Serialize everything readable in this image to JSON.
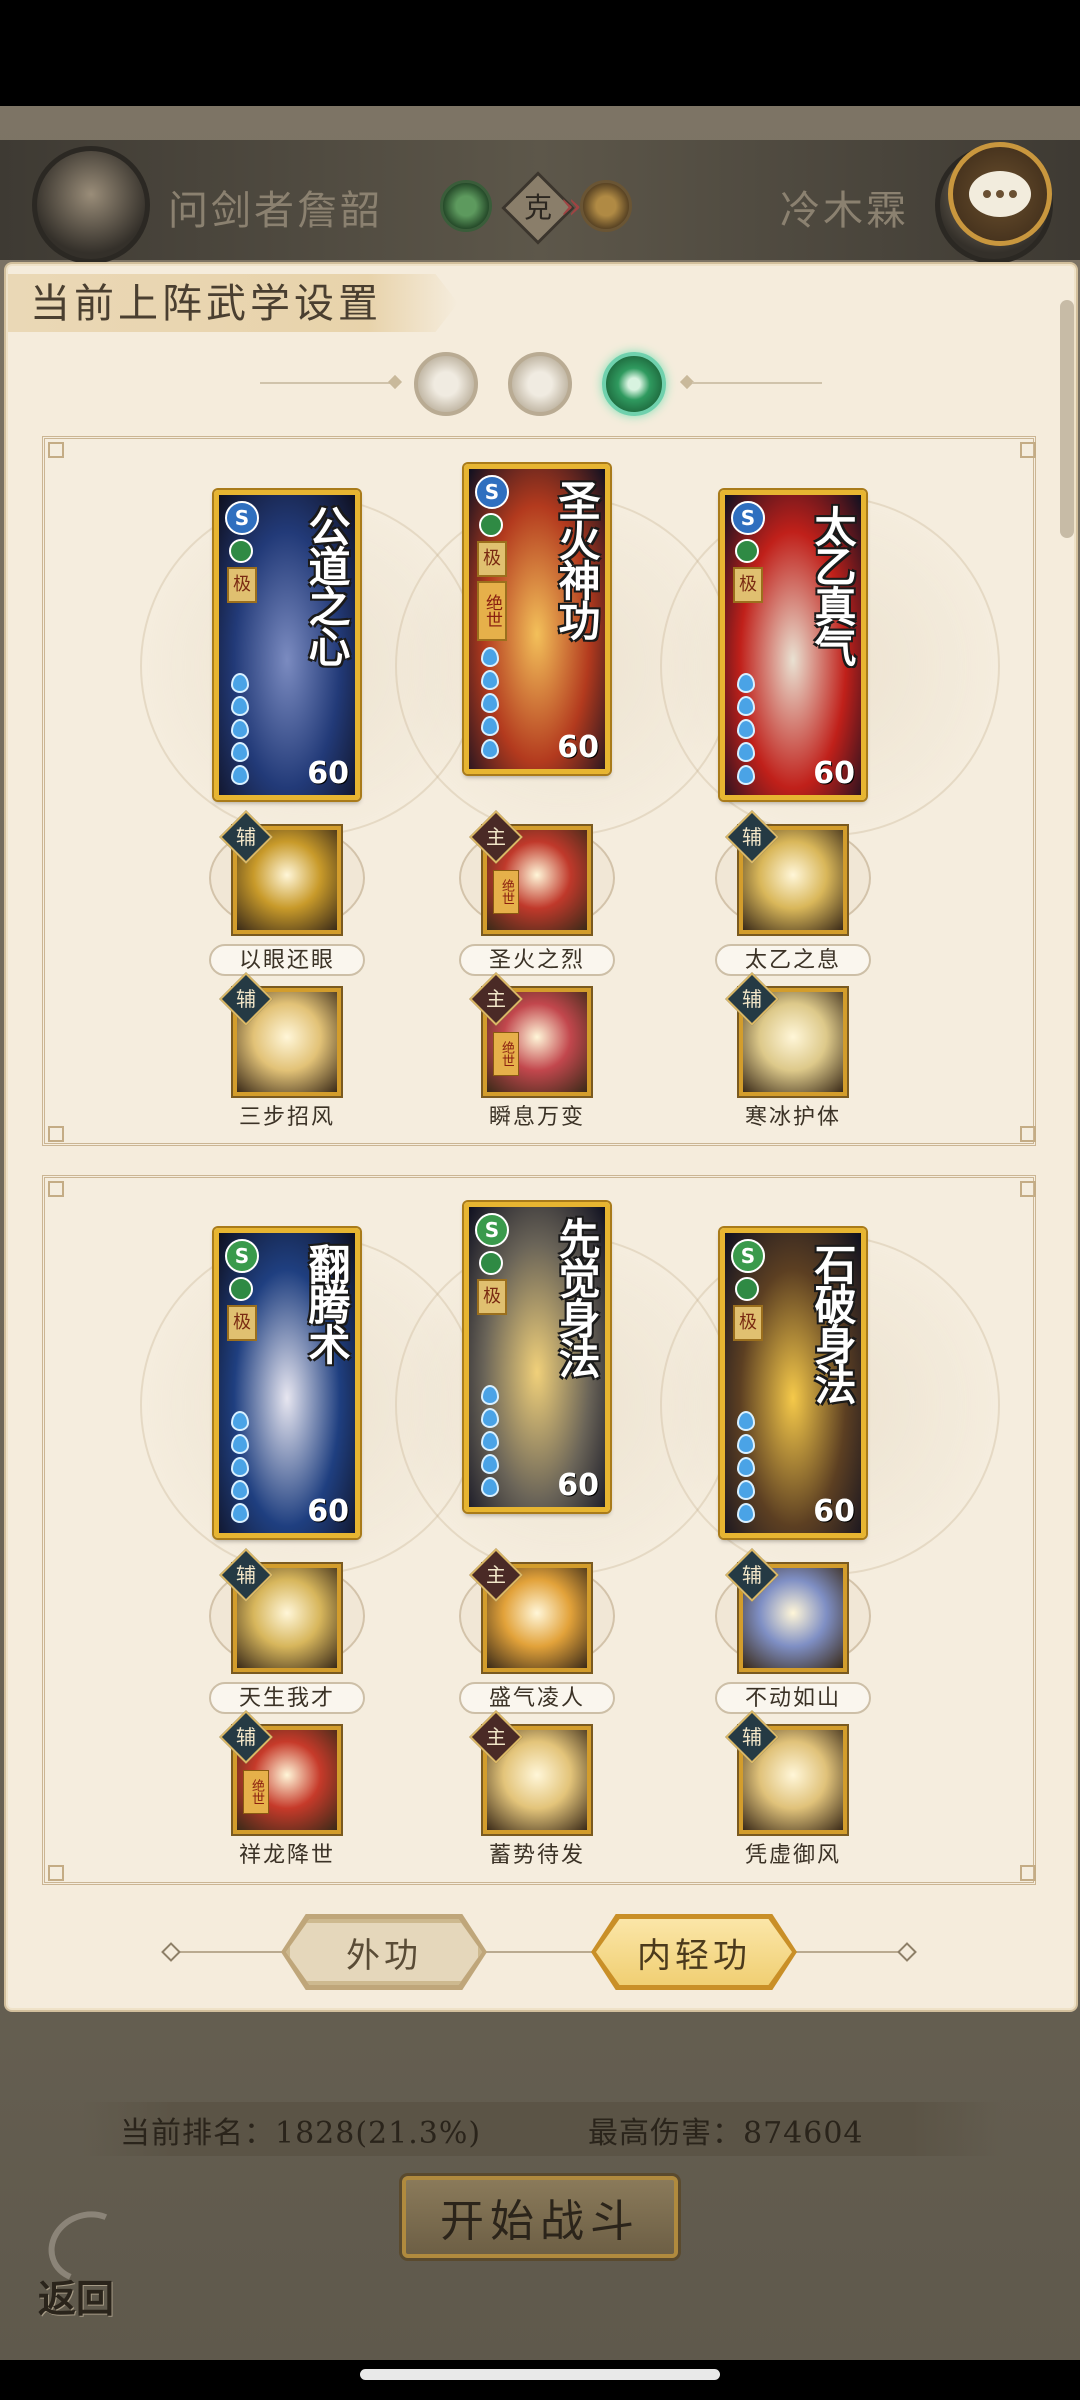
{
  "header": {
    "player_left": "问剑者詹韶",
    "player_right": "冷木霖",
    "vs_symbol": "克",
    "chat_icon": "chat-bubble-icon"
  },
  "panel": {
    "title": "当前上阵武学设置",
    "selectors": [
      "moon-icon",
      "sun-icon",
      "jade-icon"
    ],
    "selected_index": 2
  },
  "sections": [
    {
      "cards": [
        {
          "name": "公道之心",
          "level": "60",
          "grade": "极",
          "type_icon": "blue-swirl-icon",
          "art_color": "#223a78",
          "accent": "#7b8bc0"
        },
        {
          "name": "圣火神功",
          "level": "60",
          "grade": "极",
          "tag": "绝世",
          "type_icon": "blue-swirl-icon",
          "art_color": "#b33a1e",
          "accent": "#f3c05a"
        },
        {
          "name": "太乙真气",
          "level": "60",
          "grade": "极",
          "type_icon": "blue-swirl-icon",
          "art_color": "#c0201a",
          "accent": "#e9e1d2"
        }
      ],
      "skills_row1": [
        {
          "label": "以眼还眼",
          "kind": "辅",
          "main": false,
          "color": "#c89a2a"
        },
        {
          "label": "圣火之烈",
          "kind": "主",
          "main": true,
          "tag": "绝世",
          "color": "#c0392b"
        },
        {
          "label": "太乙之息",
          "kind": "辅",
          "main": false,
          "color": "#d9b75a"
        }
      ],
      "skills_row2": [
        {
          "label": "三步招风",
          "kind": "辅",
          "main": false,
          "color": "#e2c277"
        },
        {
          "label": "瞬息万变",
          "kind": "主",
          "main": true,
          "tag": "绝世",
          "color": "#c2474d"
        },
        {
          "label": "寒冰护体",
          "kind": "辅",
          "main": false,
          "color": "#ddc98a"
        }
      ]
    },
    {
      "cards": [
        {
          "name": "翻腾术",
          "level": "60",
          "grade": "极",
          "type_icon": "green-swirl-icon",
          "art_color": "#1f3f80",
          "accent": "#e7e6f0"
        },
        {
          "name": "先觉身法",
          "level": "60",
          "grade": "极",
          "type_icon": "green-swirl-icon",
          "art_color": "#6a6458",
          "accent": "#f0d07a"
        },
        {
          "name": "石破身法",
          "level": "60",
          "grade": "极",
          "type_icon": "green-swirl-icon",
          "art_color": "#5c3f22",
          "accent": "#f5c94a"
        }
      ],
      "skills_row1": [
        {
          "label": "天生我才",
          "kind": "辅",
          "main": false,
          "color": "#d7b65c"
        },
        {
          "label": "盛气凌人",
          "kind": "主",
          "main": true,
          "color": "#e2a23a"
        },
        {
          "label": "不动如山",
          "kind": "辅",
          "main": false,
          "color": "#7f8fc4"
        }
      ],
      "skills_row2": [
        {
          "label": "祥龙降世",
          "kind": "辅",
          "main": false,
          "tag": "绝世",
          "color": "#c63a2a"
        },
        {
          "label": "蓄势待发",
          "kind": "主",
          "main": true,
          "color": "#e3c47a"
        },
        {
          "label": "凭虚御风",
          "kind": "辅",
          "main": false,
          "color": "#e0c27a"
        }
      ]
    }
  ],
  "tabs": {
    "outer": "外功",
    "inner": "内轻功",
    "active": "inner"
  },
  "bottom": {
    "rank_label": "当前排名：1828(21.3%)",
    "damage_label": "最高伤害：874604",
    "start_button": "开始战斗",
    "back_label": "返回"
  }
}
